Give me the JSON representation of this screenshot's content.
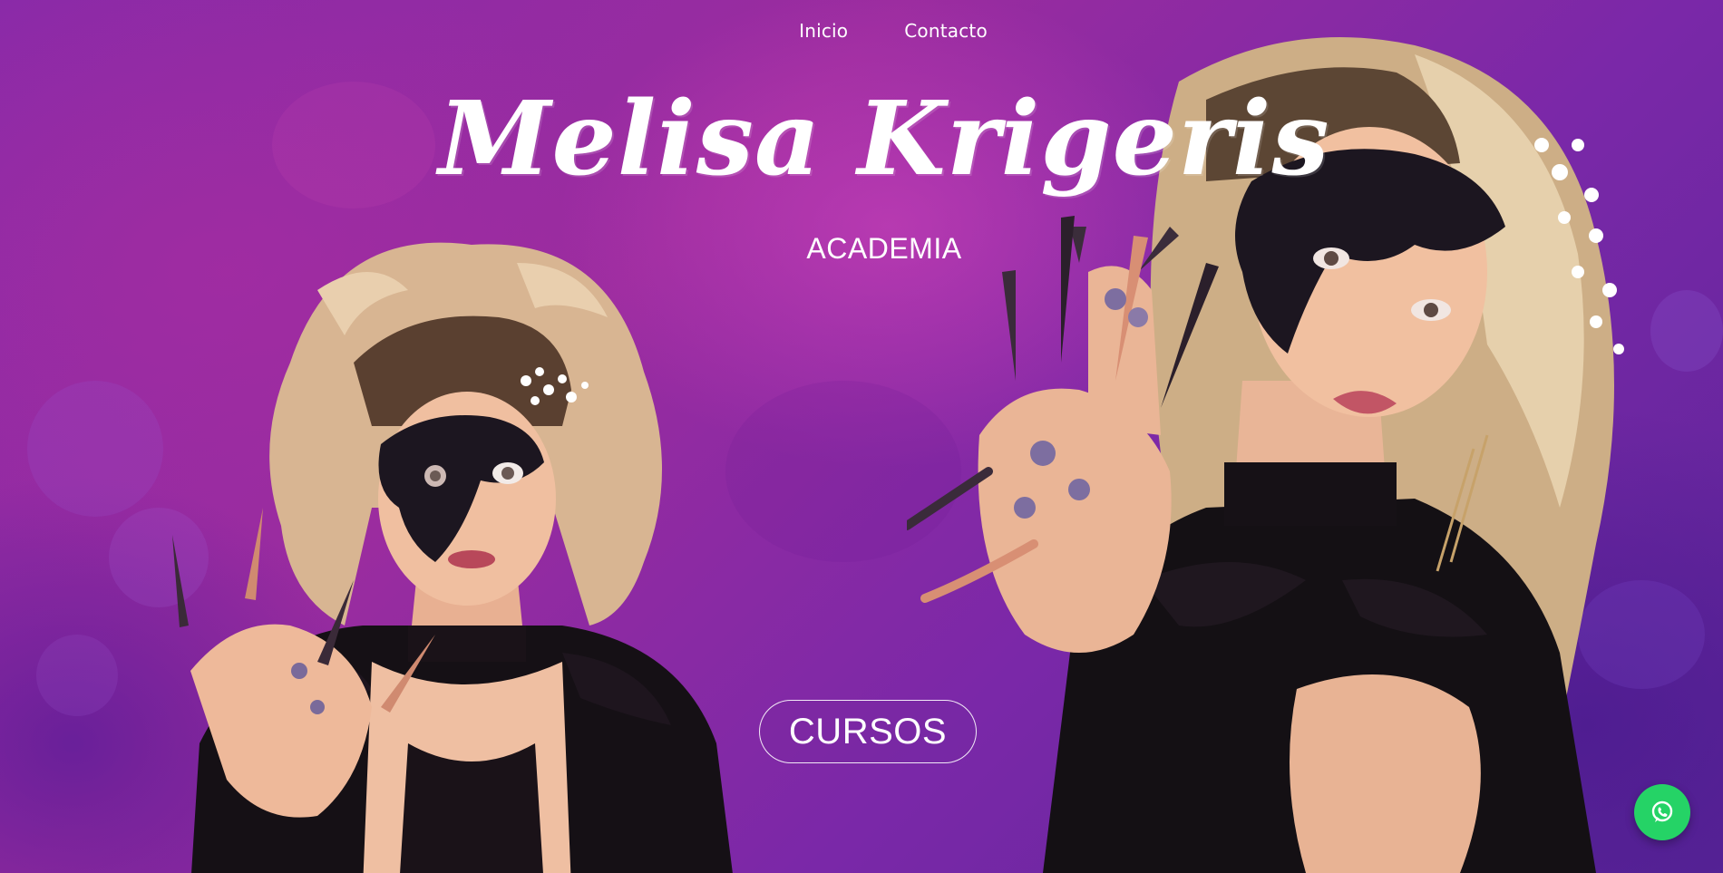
{
  "nav": {
    "items": [
      {
        "label": "Inicio"
      },
      {
        "label": "Contacto"
      }
    ]
  },
  "hero": {
    "title": "Melisa Krigeris",
    "subtitle": "ACADEMIA",
    "cta_label": "CURSOS"
  },
  "floating": {
    "icon": "whatsapp-icon",
    "color": "#25d366"
  },
  "colors": {
    "background": "#7a28a8",
    "text": "#ffffff"
  },
  "images": [
    {
      "name": "model-photo-left"
    },
    {
      "name": "model-photo-right"
    }
  ]
}
